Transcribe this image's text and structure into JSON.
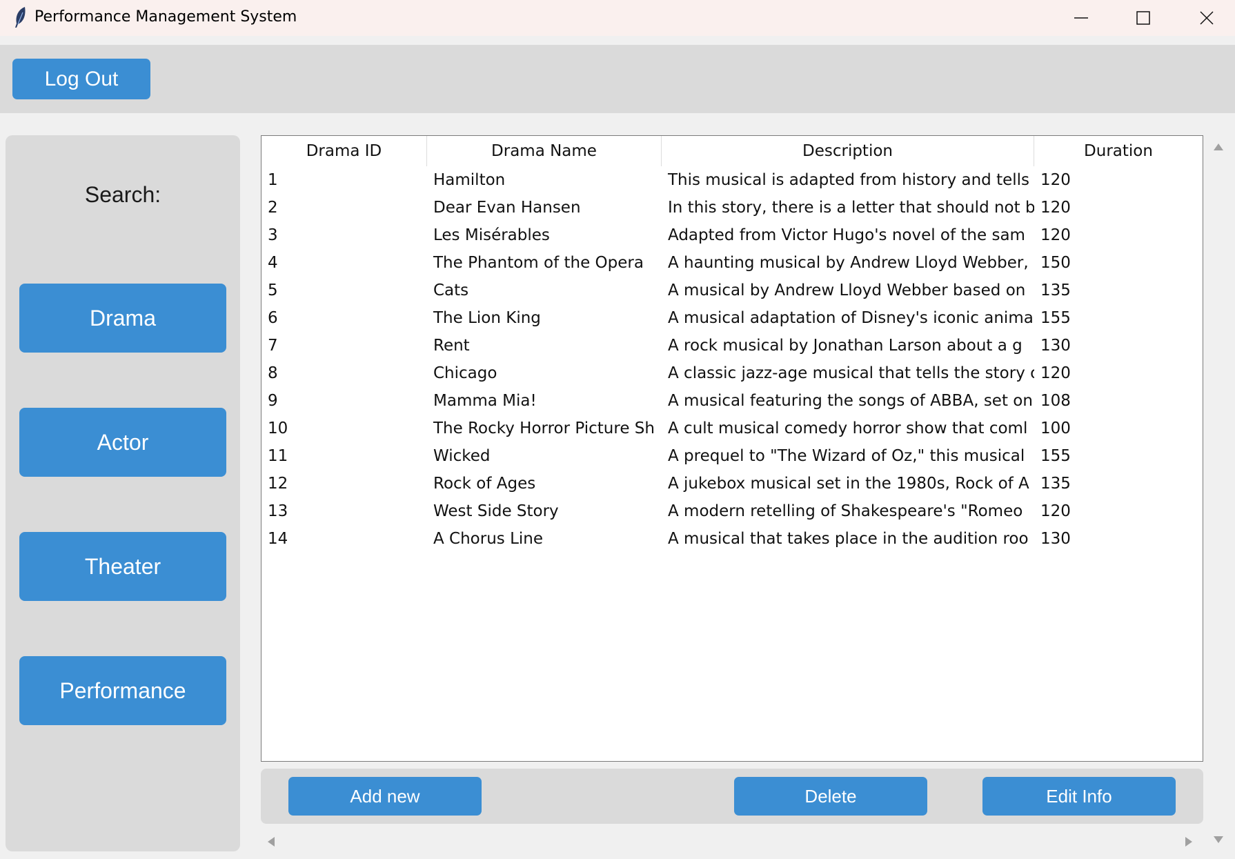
{
  "window": {
    "title": "Performance Management System"
  },
  "topbar": {
    "logout_label": "Log Out"
  },
  "sidebar": {
    "search_label": "Search:",
    "items": [
      {
        "label": "Drama"
      },
      {
        "label": "Actor"
      },
      {
        "label": "Theater"
      },
      {
        "label": "Performance"
      }
    ]
  },
  "table": {
    "columns": [
      "Drama ID",
      "Drama Name",
      "Description",
      "Duration"
    ],
    "rows": [
      [
        "1",
        "Hamilton",
        "This musical is adapted from history and tells",
        "120"
      ],
      [
        "2",
        "Dear Evan Hansen",
        "In this story, there is a letter that should not b",
        "120"
      ],
      [
        "3",
        "Les Misérables",
        "Adapted from Victor Hugo's novel of the sam",
        "120"
      ],
      [
        "4",
        "The Phantom of the Opera",
        "A haunting musical by Andrew Lloyd Webber,",
        "150"
      ],
      [
        "5",
        "Cats",
        "A musical by Andrew Lloyd Webber based on",
        "135"
      ],
      [
        "6",
        "The Lion King",
        "A musical adaptation of Disney's iconic anima",
        "155"
      ],
      [
        "7",
        "Rent",
        "A rock musical by Jonathan Larson about a g",
        "130"
      ],
      [
        "8",
        "Chicago",
        "A classic jazz-age musical that tells the story o",
        "120"
      ],
      [
        "9",
        "Mamma Mia!",
        "A musical featuring the songs of ABBA, set on",
        "108"
      ],
      [
        "10",
        "The Rocky Horror Picture Sh",
        "A cult musical comedy horror show that coml",
        "100"
      ],
      [
        "11",
        "Wicked",
        "A prequel to \"The Wizard of Oz,\" this musical",
        "155"
      ],
      [
        "12",
        "Rock of Ages",
        "A jukebox musical set in the 1980s, Rock of A",
        "135"
      ],
      [
        "13",
        "West Side Story",
        "A modern retelling of Shakespeare's \"Romeo",
        "120"
      ],
      [
        "14",
        "A Chorus Line",
        "A musical that takes place in the audition roo",
        "130"
      ]
    ]
  },
  "actions": {
    "add_label": "Add new",
    "delete_label": "Delete",
    "edit_label": "Edit Info"
  },
  "colors": {
    "accent": "#3b8ed3",
    "panel": "#dadada"
  }
}
